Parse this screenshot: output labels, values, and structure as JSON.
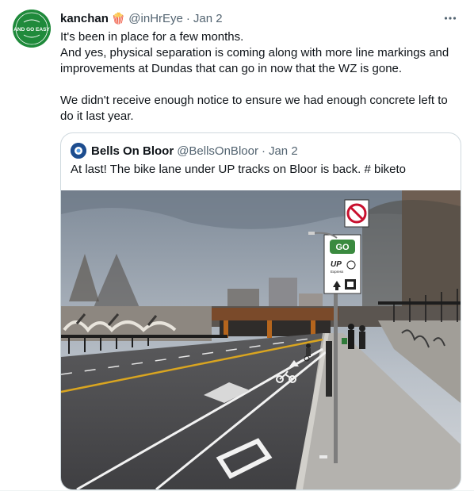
{
  "tweet": {
    "display_name": "kanchan",
    "name_emoji": "🍿",
    "handle": "@inHrEye",
    "separator": "·",
    "date": "Jan 2",
    "more_icon": "more-horizontal-icon",
    "text": "It's been in place for a few months.\nAnd yes, physical separation is coming along with more line markings and improvements at Dundas that can go in now that the WZ is gone.\n\nWe didn't receive enough notice to ensure we had enough concrete left to do it last year.",
    "avatar_text": "AND GO EASY"
  },
  "quote": {
    "display_name": "Bells On Bloor",
    "handle": "@BellsOnBloor",
    "separator": "·",
    "date": "Jan 2",
    "text": "At last! The bike lane under UP tracks on Bloor is back. # biketo",
    "sign_up_label": "UP",
    "sign_up_sub": "Express"
  },
  "colors": {
    "text_primary": "#0f1419",
    "text_secondary": "#536471",
    "border": "#cfd9de",
    "avatar_green": "#1f8a3b",
    "go_green": "#3a8a3f"
  }
}
